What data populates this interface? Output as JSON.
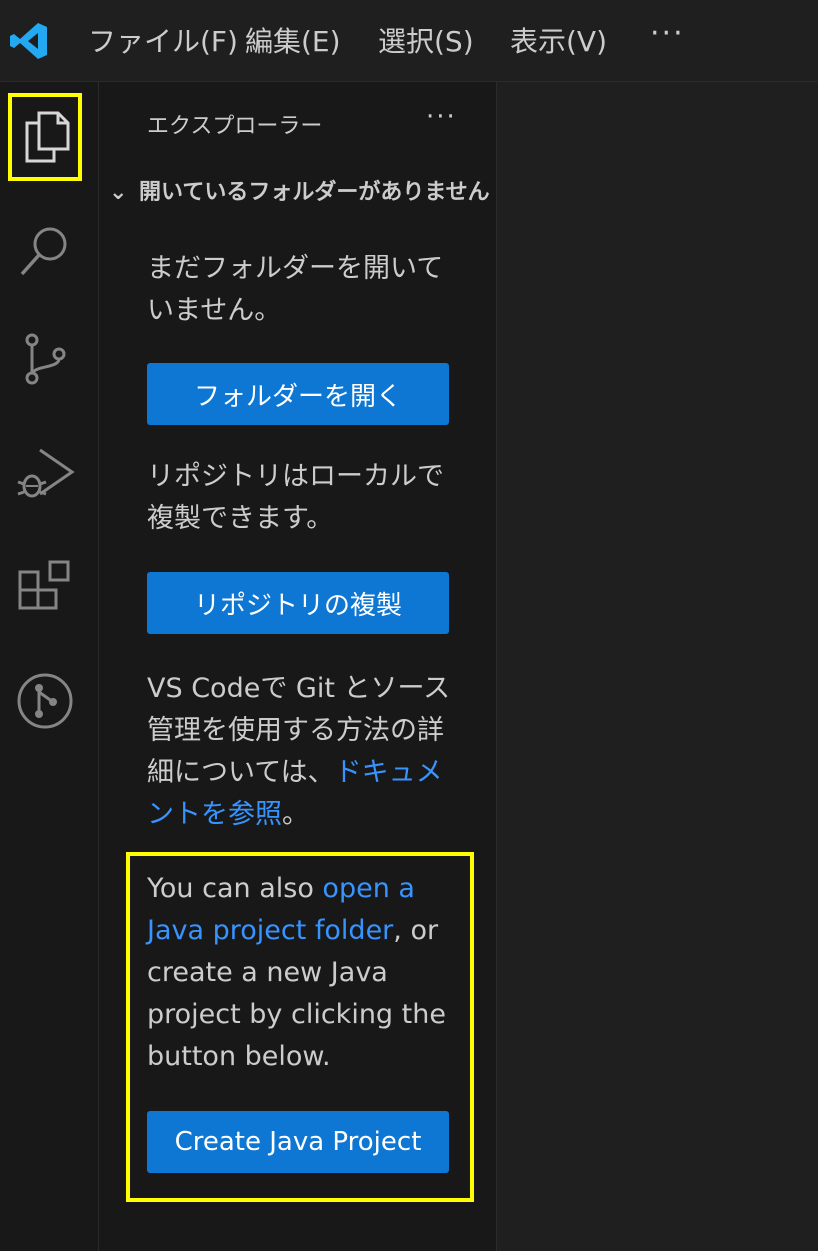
{
  "menu": {
    "items": [
      "ファイル(F)",
      "編集(E)",
      "選択(S)",
      "表示(V)"
    ],
    "more": "···"
  },
  "activity_bar": {
    "icons": [
      "explorer-icon",
      "search-icon",
      "source-control-icon",
      "run-debug-icon",
      "extensions-icon",
      "git-graph-icon"
    ]
  },
  "sidebar": {
    "title": "エクスプローラー",
    "more": "···",
    "section": "開いているフォルダーがありません",
    "no_folder_text": "まだフォルダーを開いていません。",
    "open_folder_button": "フォルダーを開く",
    "clone_text": "リポジトリはローカルで複製できます。",
    "clone_button": "リポジトリの複製",
    "git_text_before": "VS Codeで Git とソース管理を使用する方法の詳細については、",
    "git_link": "ドキュメントを参照",
    "git_text_after": "。",
    "java_text_1": "You can also ",
    "java_link": "open a Java project folder",
    "java_text_2": ", or create a new Java project by clicking the button below.",
    "create_java_button": "Create Java Project"
  },
  "colors": {
    "accent": "#0e76d3",
    "link": "#3794ff",
    "highlight": "#ffff00",
    "logo": "#23a9f2"
  }
}
